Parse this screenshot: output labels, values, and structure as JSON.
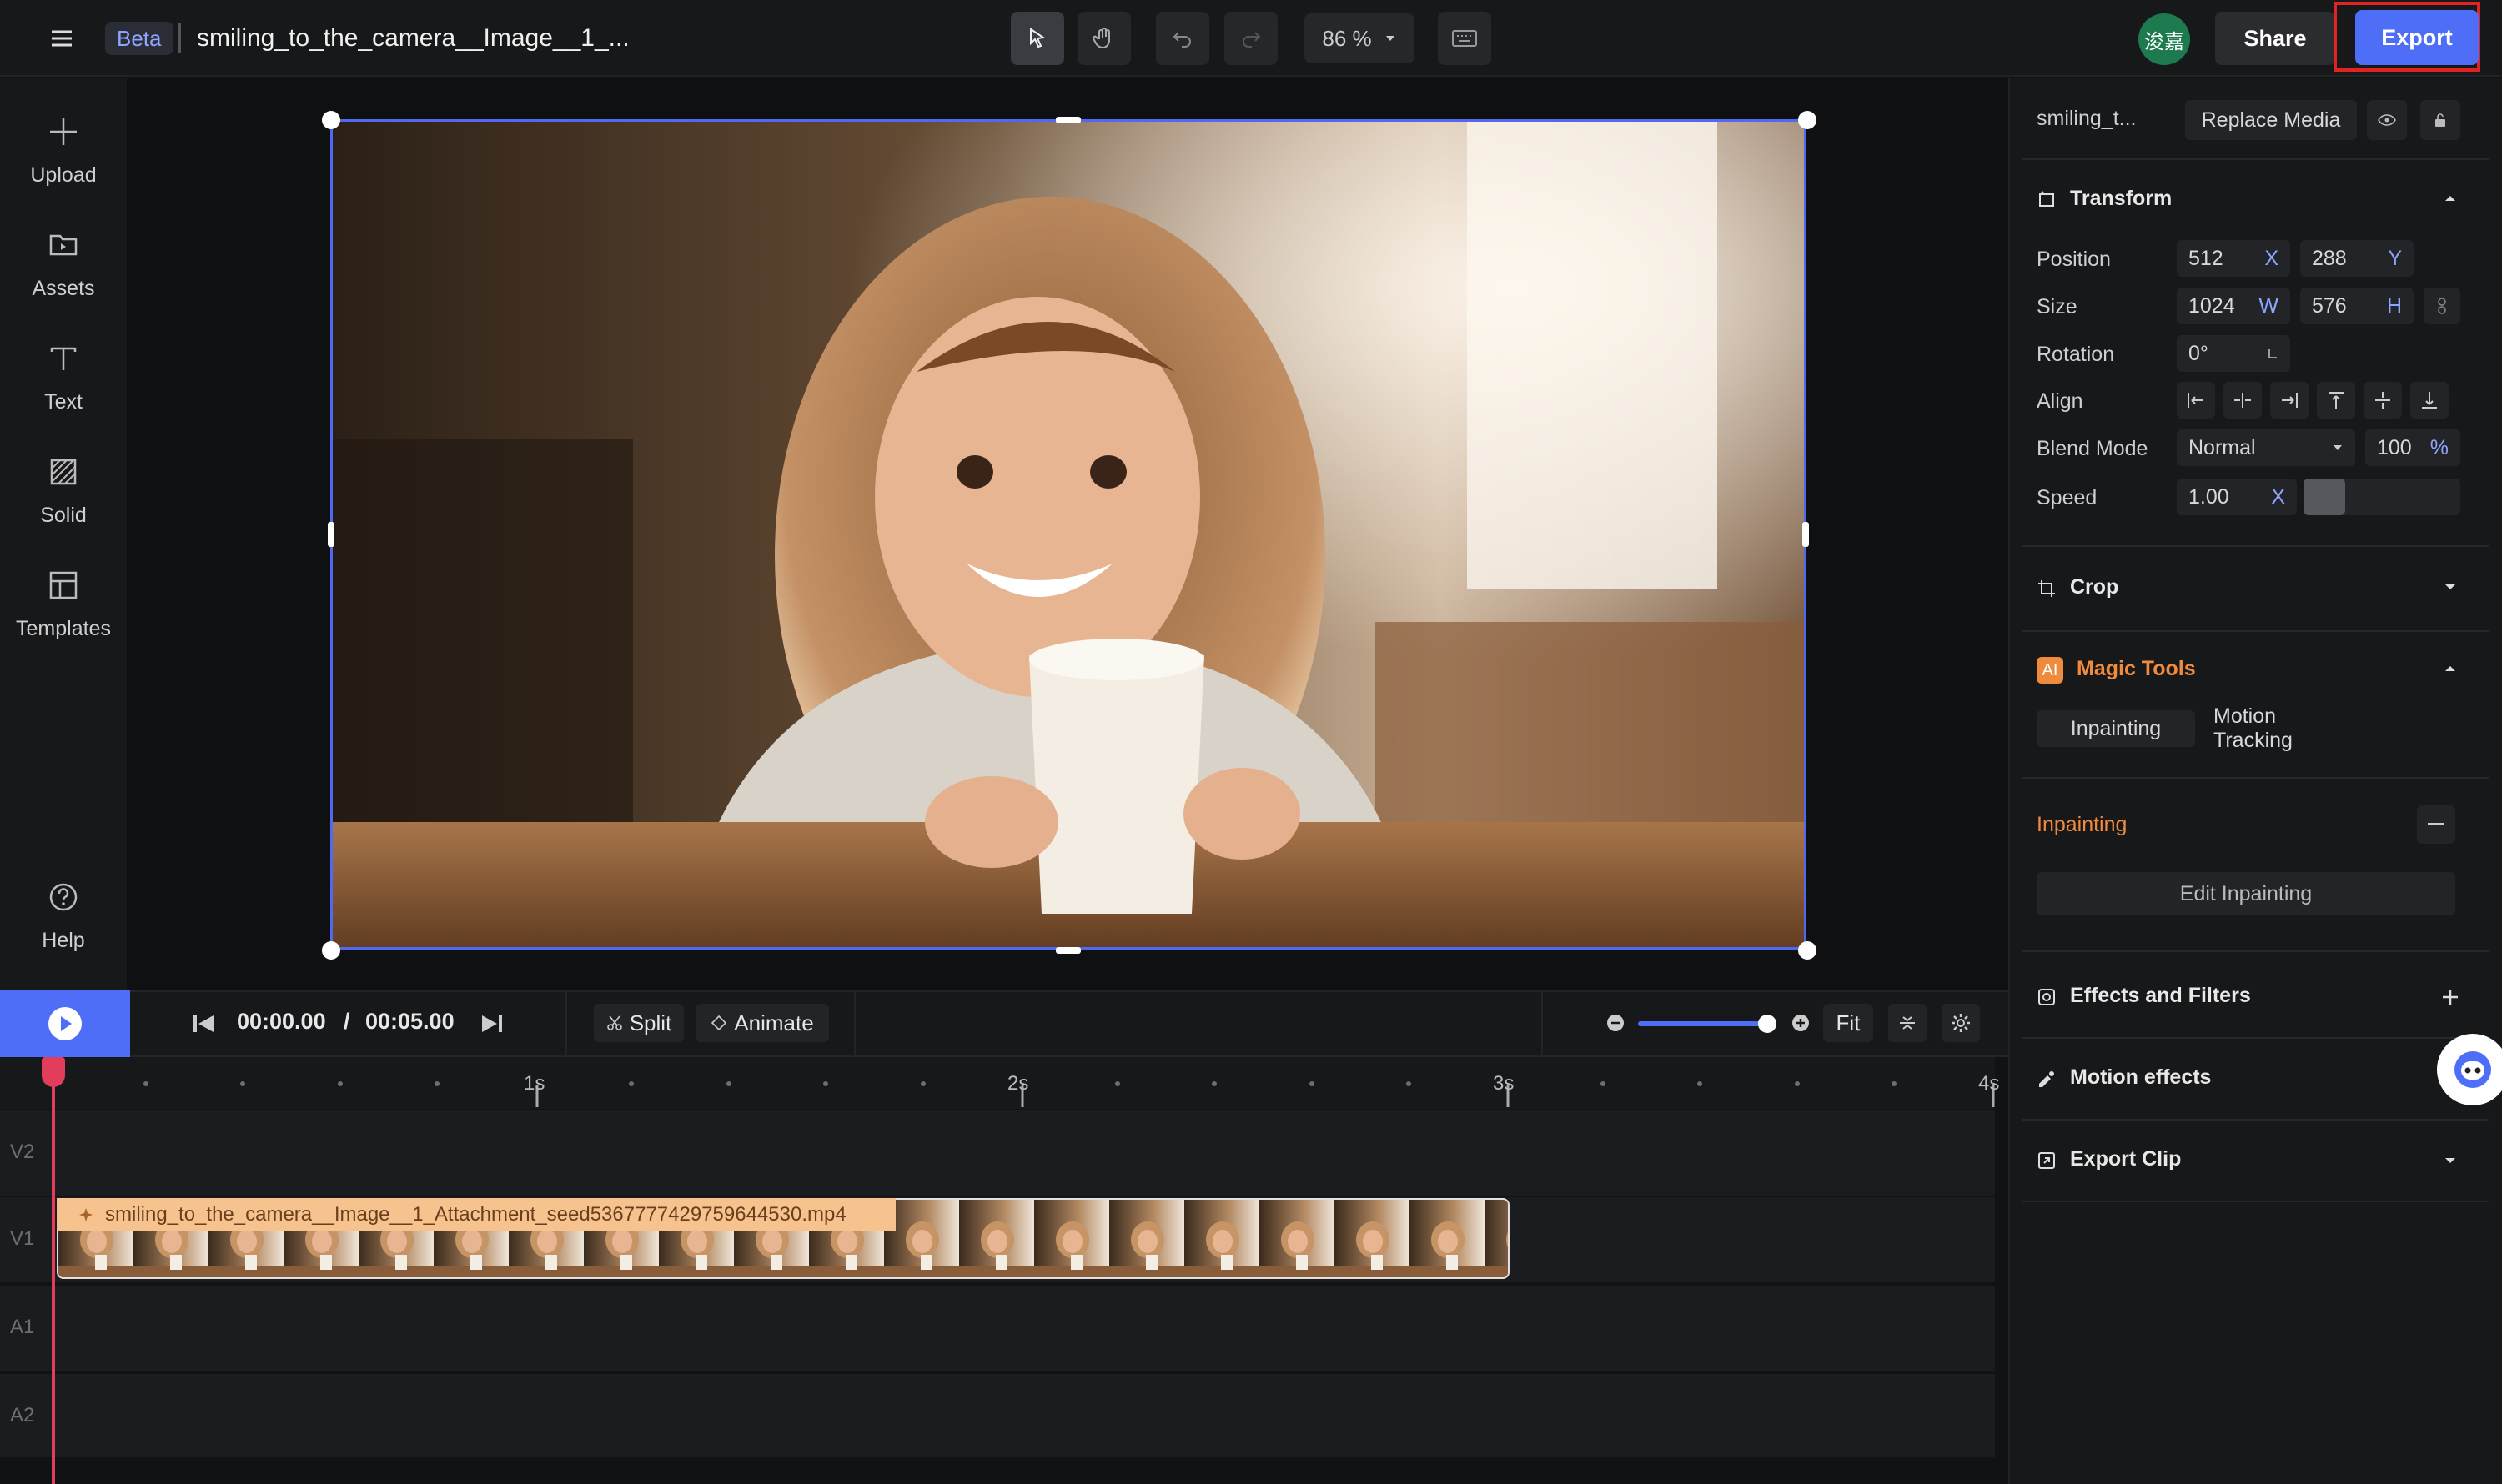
{
  "header": {
    "badge": "Beta",
    "title": "smiling_to_the_camera__Image__1_...",
    "zoom": "86 %",
    "share_label": "Share",
    "export_label": "Export",
    "avatar_text": "浚嘉"
  },
  "sidebar": {
    "items": [
      {
        "label": "Upload",
        "icon": "plus-icon"
      },
      {
        "label": "Assets",
        "icon": "folder-icon"
      },
      {
        "label": "Text",
        "icon": "text-icon"
      },
      {
        "label": "Solid",
        "icon": "solid-icon"
      },
      {
        "label": "Templates",
        "icon": "templates-icon"
      }
    ],
    "help_label": "Help"
  },
  "playback": {
    "current_time": "00:00.00",
    "separator": "/",
    "total_time": "00:05.00",
    "split_label": "Split",
    "animate_label": "Animate",
    "fit_label": "Fit"
  },
  "timeline": {
    "ticks": [
      "1s",
      "2s",
      "3s",
      "4s"
    ],
    "tracks": [
      "V2",
      "V1",
      "A1",
      "A2"
    ],
    "clip_name": "smiling_to_the_camera__Image__1_Attachment_seed5367777429759644530.mp4"
  },
  "right_panel": {
    "media_name": "smiling_t...",
    "replace_media_label": "Replace Media",
    "transform": {
      "title": "Transform",
      "position_label": "Position",
      "position_x": "512",
      "position_x_unit": "X",
      "position_y": "288",
      "position_y_unit": "Y",
      "size_label": "Size",
      "size_w": "1024",
      "size_w_unit": "W",
      "size_h": "576",
      "size_h_unit": "H",
      "rotation_label": "Rotation",
      "rotation": "0°",
      "align_label": "Align",
      "blend_label": "Blend Mode",
      "blend_mode": "Normal",
      "opacity": "100",
      "opacity_unit": "%",
      "speed_label": "Speed",
      "speed": "1.00",
      "speed_unit": "X"
    },
    "crop_title": "Crop",
    "magic": {
      "badge": "AI",
      "title": "Magic Tools",
      "tabs": [
        "Inpainting",
        "Motion Tracking"
      ],
      "sub_title": "Inpainting",
      "edit_label": "Edit Inpainting"
    },
    "effects_title": "Effects and Filters",
    "motion_title": "Motion effects",
    "export_clip_title": "Export Clip"
  },
  "colors": {
    "accent": "#4f6ef7",
    "magic_orange": "#f08a3c",
    "playhead": "#e23d5a",
    "highlight": "#e02424"
  }
}
